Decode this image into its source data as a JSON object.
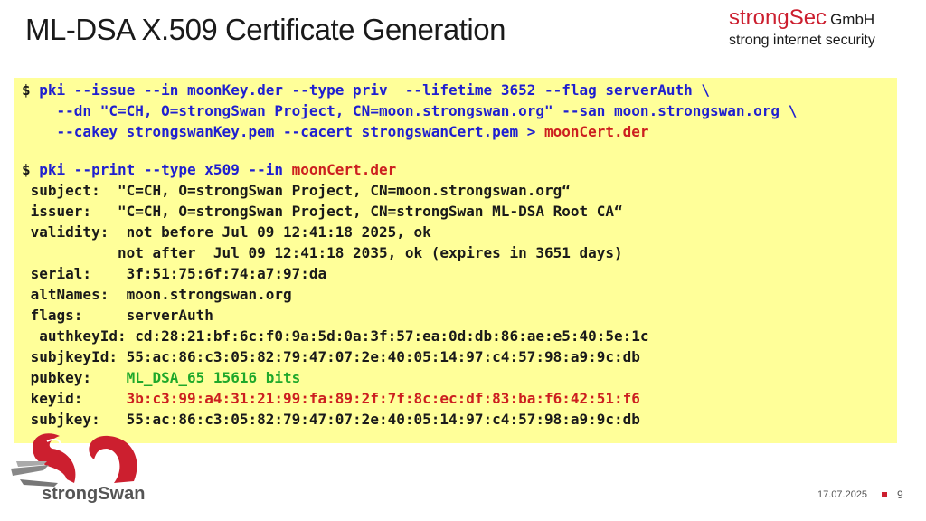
{
  "slide": {
    "title": "ML-DSA X.509 Certificate Generation",
    "brand_name": "strongSec",
    "brand_suffix": "GmbH",
    "brand_tagline": "strong internet security",
    "footer_date": "17.07.2025",
    "page_number": "9",
    "logo_text": "strongSwan"
  },
  "terminal": {
    "l1_prompt": "$",
    "l1_cmd": " pki --issue --in moonKey.der --type priv  --lifetime 3652 --flag serverAuth \\",
    "l2_cmd": "    --dn \"C=CH, O=strongSwan Project, CN=moon.strongswan.org\" --san moon.strongswan.org \\",
    "l3_cmd": "    --cakey strongswanKey.pem --cacert strongswanCert.pem > ",
    "l3_file": "moonCert.der",
    "l4_prompt": "$",
    "l4_cmd": " pki --print --type x509 --in ",
    "l4_file": "moonCert.der",
    "subject": " subject:  \"C=CH, O=strongSwan Project, CN=moon.strongswan.org“",
    "issuer": " issuer:   \"C=CH, O=strongSwan Project, CN=strongSwan ML-DSA Root CA“",
    "validity": " validity:  not before Jul 09 12:41:18 2025, ok",
    "not_after": "           not after  Jul 09 12:41:18 2035, ok (expires in 3651 days)",
    "serial": " serial:    3f:51:75:6f:74:a7:97:da",
    "altnames": " altNames:  moon.strongswan.org",
    "flags": " flags:     serverAuth",
    "authkeyid": "  authkeyId: cd:28:21:bf:6c:f0:9a:5d:0a:3f:57:ea:0d:db:86:ae:e5:40:5e:1c",
    "subjkeyid": " subjkeyId: 55:ac:86:c3:05:82:79:47:07:2e:40:05:14:97:c4:57:98:a9:9c:db",
    "pubkey_label": " pubkey:    ",
    "pubkey_value": "ML_DSA_65 15616 bits",
    "keyid_label": " keyid:     ",
    "keyid_value": "3b:c3:99:a4:31:21:99:fa:89:2f:7f:8c:ec:df:83:ba:f6:42:51:f6",
    "subjkey": " subjkey:   55:ac:86:c3:05:82:79:47:07:2e:40:05:14:97:c4:57:98:a9:9c:db"
  },
  "colors": {
    "brand_red": "#cc1f2f",
    "terminal_bg": "#ffff99",
    "command_blue": "#1f1fd0",
    "highlight_red": "#cc1f1f",
    "highlight_green": "#1fa82a"
  }
}
